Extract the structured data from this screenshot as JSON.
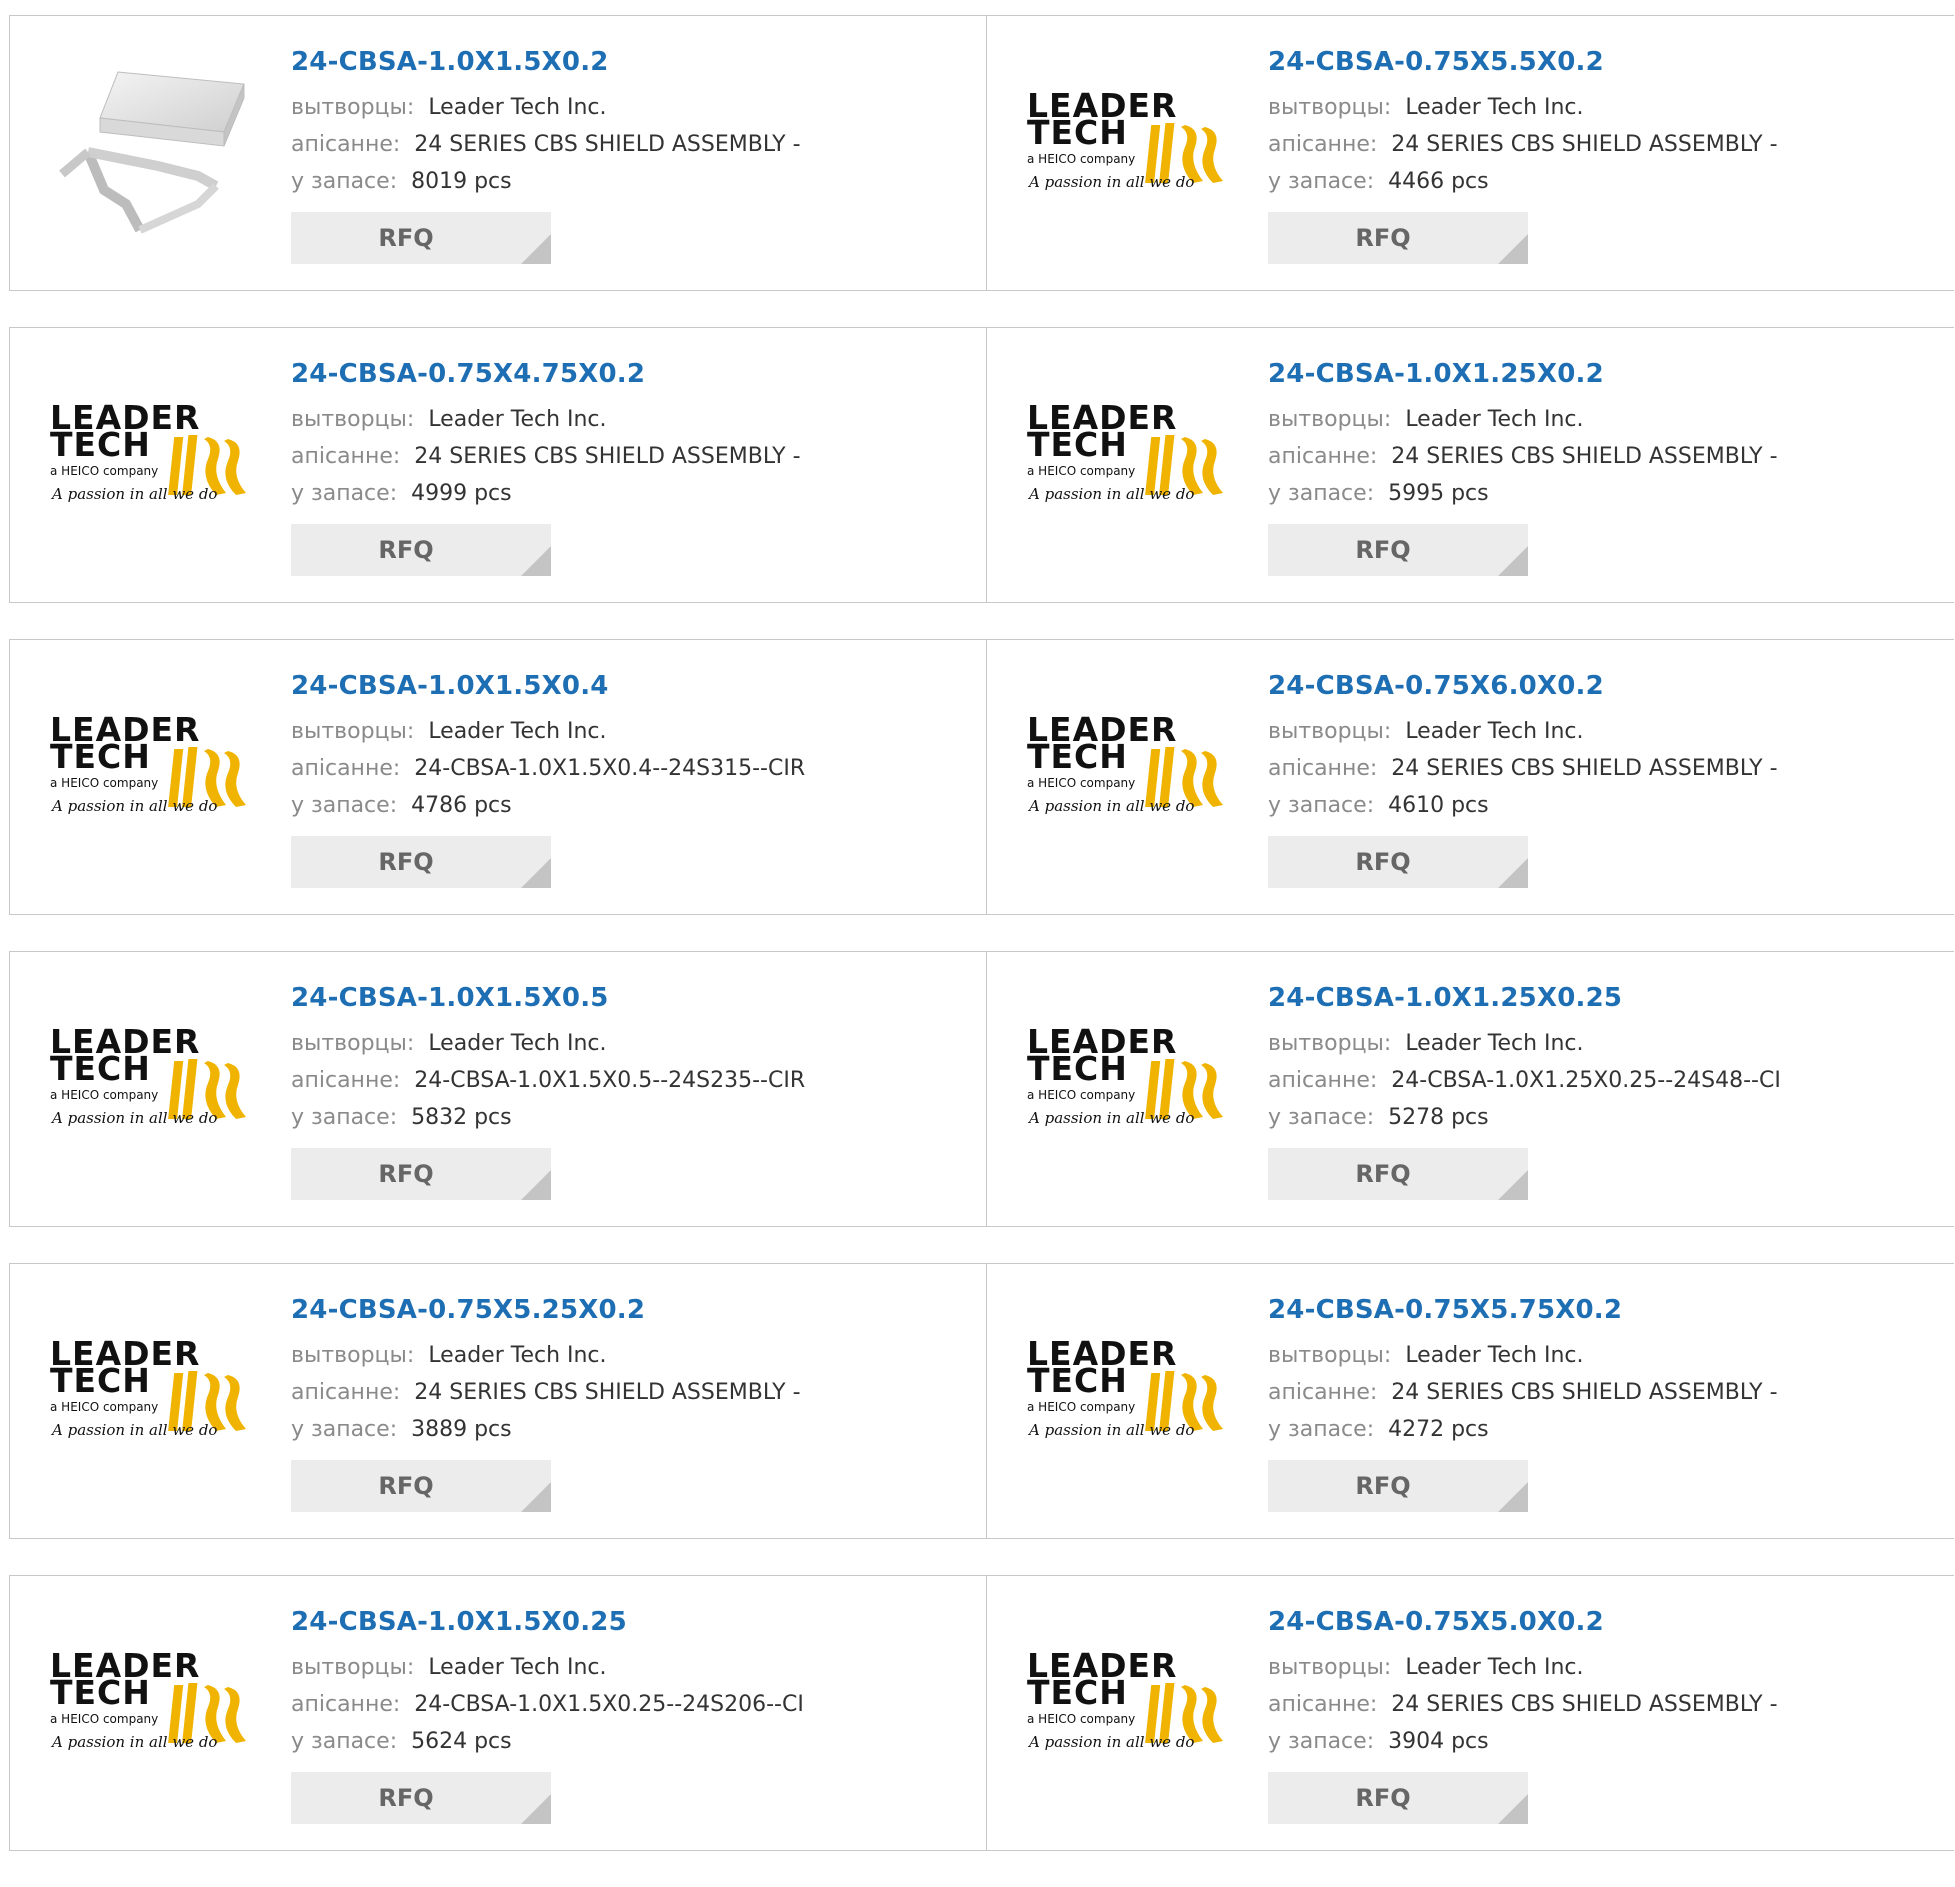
{
  "labels": {
    "manufacturer": "вытворцы:",
    "description": "апісанне:",
    "stock": "у запасе:",
    "rfq": "RFQ"
  },
  "logo": {
    "line1": "LEADER",
    "line2": "TECH",
    "line3": "a HEICO company",
    "tagline": "A passion in all we do"
  },
  "products": [
    {
      "part": "24-CBSA-1.0X1.5X0.2",
      "manufacturer": "Leader Tech Inc.",
      "description": "24 SERIES CBS SHIELD ASSEMBLY -",
      "stock": "8019 pcs",
      "image": "shield-photo"
    },
    {
      "part": "24-CBSA-0.75X5.5X0.2",
      "manufacturer": "Leader Tech Inc.",
      "description": "24 SERIES CBS SHIELD ASSEMBLY -",
      "stock": "4466 pcs",
      "image": "leader-tech-logo"
    },
    {
      "part": "24-CBSA-0.75X4.75X0.2",
      "manufacturer": "Leader Tech Inc.",
      "description": "24 SERIES CBS SHIELD ASSEMBLY -",
      "stock": "4999 pcs",
      "image": "leader-tech-logo"
    },
    {
      "part": "24-CBSA-1.0X1.25X0.2",
      "manufacturer": "Leader Tech Inc.",
      "description": "24 SERIES CBS SHIELD ASSEMBLY -",
      "stock": "5995 pcs",
      "image": "leader-tech-logo"
    },
    {
      "part": "24-CBSA-1.0X1.5X0.4",
      "manufacturer": "Leader Tech Inc.",
      "description": "24-CBSA-1.0X1.5X0.4--24S315--CIR",
      "stock": "4786 pcs",
      "image": "leader-tech-logo"
    },
    {
      "part": "24-CBSA-0.75X6.0X0.2",
      "manufacturer": "Leader Tech Inc.",
      "description": "24 SERIES CBS SHIELD ASSEMBLY -",
      "stock": "4610 pcs",
      "image": "leader-tech-logo"
    },
    {
      "part": "24-CBSA-1.0X1.5X0.5",
      "manufacturer": "Leader Tech Inc.",
      "description": "24-CBSA-1.0X1.5X0.5--24S235--CIR",
      "stock": "5832 pcs",
      "image": "leader-tech-logo"
    },
    {
      "part": "24-CBSA-1.0X1.25X0.25",
      "manufacturer": "Leader Tech Inc.",
      "description": "24-CBSA-1.0X1.25X0.25--24S48--CI",
      "stock": "5278 pcs",
      "image": "leader-tech-logo"
    },
    {
      "part": "24-CBSA-0.75X5.25X0.2",
      "manufacturer": "Leader Tech Inc.",
      "description": "24 SERIES CBS SHIELD ASSEMBLY -",
      "stock": "3889 pcs",
      "image": "leader-tech-logo"
    },
    {
      "part": "24-CBSA-0.75X5.75X0.2",
      "manufacturer": "Leader Tech Inc.",
      "description": "24 SERIES CBS SHIELD ASSEMBLY -",
      "stock": "4272 pcs",
      "image": "leader-tech-logo"
    },
    {
      "part": "24-CBSA-1.0X1.5X0.25",
      "manufacturer": "Leader Tech Inc.",
      "description": "24-CBSA-1.0X1.5X0.25--24S206--CI",
      "stock": "5624 pcs",
      "image": "leader-tech-logo"
    },
    {
      "part": "24-CBSA-0.75X5.0X0.2",
      "manufacturer": "Leader Tech Inc.",
      "description": "24 SERIES CBS SHIELD ASSEMBLY -",
      "stock": "3904 pcs",
      "image": "leader-tech-logo"
    }
  ],
  "colors": {
    "part_link": "#1e6eb4",
    "label_gray": "#8a8a8a",
    "logo_black": "#111111",
    "logo_gold": "#f0b400",
    "rfq_bg": "#ececec",
    "border": "#c8c8c8"
  }
}
